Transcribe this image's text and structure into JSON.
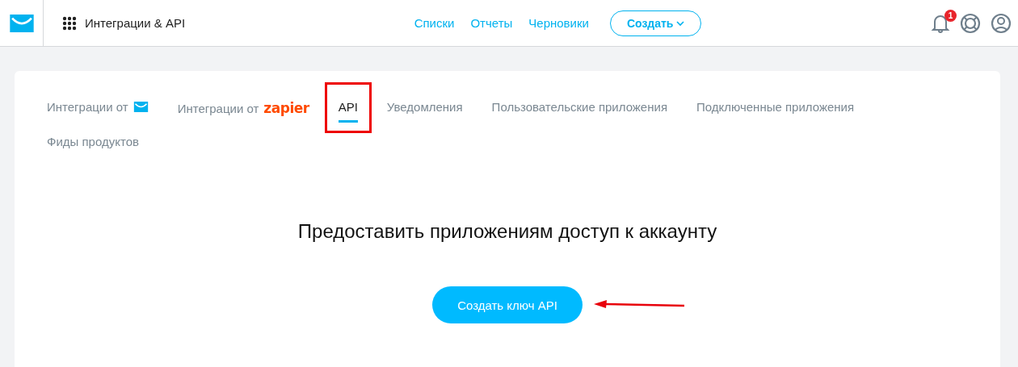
{
  "header": {
    "section_title": "Интеграции & API",
    "nav": [
      "Списки",
      "Отчеты",
      "Черновики"
    ],
    "create_button": "Создать",
    "notification_count": "1"
  },
  "tabs": [
    {
      "label": "Интеграции от",
      "kind": "envelope",
      "selected": false,
      "annotated": false
    },
    {
      "label": "Интеграции от",
      "kind": "zapier",
      "logo_text": "zapier",
      "selected": false,
      "annotated": false
    },
    {
      "label": "API",
      "selected": true,
      "annotated": true
    },
    {
      "label": "Уведомления",
      "selected": false,
      "annotated": false
    },
    {
      "label": "Пользовательские приложения",
      "selected": false,
      "annotated": false
    },
    {
      "label": "Подключенные приложения",
      "selected": false,
      "annotated": false
    },
    {
      "label": "Фиды продуктов",
      "selected": false,
      "annotated": false
    }
  ],
  "heading": "Предоставить приложениям доступ к аккаунту",
  "primary_button": {
    "label": "Создать ключ API",
    "annotated": true
  }
}
